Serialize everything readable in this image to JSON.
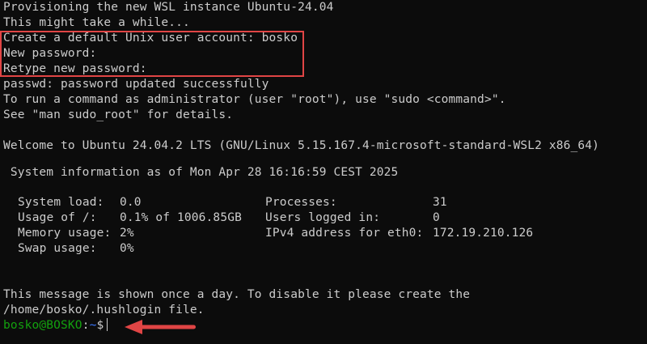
{
  "lines": {
    "l1": "Provisioning the new WSL instance Ubuntu-24.04",
    "l2": "This might take a while...",
    "l3": "Create a default Unix user account: bosko",
    "l4": "New password:",
    "l5": "Retype new password:",
    "l6": "passwd: password updated successfully",
    "l7": "To run a command as administrator (user \"root\"), use \"sudo <command>\".",
    "l8": "See \"man sudo_root\" for details.",
    "l9": "Welcome to Ubuntu 24.04.2 LTS (GNU/Linux 5.15.167.4-microsoft-standard-WSL2 x86_64)",
    "l10": " System information as of Mon Apr 28 16:16:59 CEST 2025",
    "l11": "This message is shown once a day. To disable it please create the",
    "l12": "/home/bosko/.hushlogin file."
  },
  "sysinfo": {
    "system_load_label": "System load:",
    "system_load_value": "0.0",
    "usage_label": "Usage of /:",
    "usage_value": "0.1% of 1006.85GB",
    "memory_label": "Memory usage:",
    "memory_value": "2%",
    "swap_label": "Swap usage:",
    "swap_value": "0%",
    "processes_label": "Processes:",
    "processes_value": "31",
    "users_label": "Users logged in:",
    "users_value": "0",
    "ipv4_label": "IPv4 address for eth0:",
    "ipv4_value": "172.19.210.126"
  },
  "prompt": {
    "user_host": "bosko@BOSKO",
    "separator": ":",
    "path": "~",
    "symbol": "$"
  },
  "colors": {
    "background": "#0c0c0c",
    "text": "#cccccc",
    "prompt_user": "#13a10e",
    "prompt_path": "#3b78ff",
    "annotation": "#e04545"
  },
  "icons": {
    "annotation_arrow": "left-arrow-icon"
  }
}
